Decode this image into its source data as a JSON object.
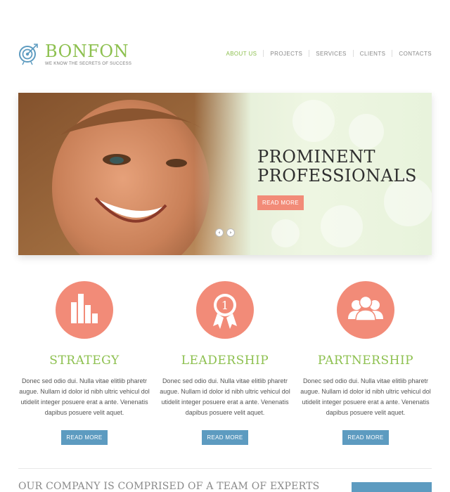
{
  "brand": {
    "title": "BONFON",
    "tagline": "WE KNOW THE SECRETS OF SUCCESS"
  },
  "nav": {
    "items": [
      {
        "label": "ABOUT US",
        "active": true
      },
      {
        "label": "PROJECTS",
        "active": false
      },
      {
        "label": "SERVICES",
        "active": false
      },
      {
        "label": "CLIENTS",
        "active": false
      },
      {
        "label": "CONTACTS",
        "active": false
      }
    ]
  },
  "slider": {
    "title_line1": "PROMINENT",
    "title_line2": "PROFESSIONALS",
    "button_label": "READ MORE",
    "prev_icon": "‹",
    "next_icon": "›"
  },
  "features": [
    {
      "icon": "bar-chart-icon",
      "title": "STRATEGY",
      "text": "Donec sed odio dui. Nulla vitae elitlib pharetr augue. Nullam id dolor id nibh ultric vehicul dol utidelit integer posuere erat a ante. Venenatis dapibus posuere velit aquet.",
      "button_label": "READ MORE"
    },
    {
      "icon": "award-ribbon-icon",
      "award_number": "1",
      "title": "LEADERSHIP",
      "text": "Donec sed odio dui. Nulla vitae elitlib pharetr augue. Nullam id dolor id nibh ultric vehicul dol utidelit integer posuere erat a ante. Venenatis dapibus posuere velit aquet.",
      "button_label": "READ MORE"
    },
    {
      "icon": "people-group-icon",
      "title": "PARTNERSHIP",
      "text": "Donec sed odio dui. Nulla vitae elitlib pharetr augue. Nullam id dolor id nibh ultric vehicul dol utidelit integer posuere erat a ante. Venenatis dapibus posuere velit aquet.",
      "button_label": "READ MORE"
    }
  ],
  "bottom": {
    "heading": "OUR COMPANY IS COMPRISED OF A TEAM OF EXPERTS"
  },
  "colors": {
    "brand_green": "#8dc04f",
    "accent_salmon": "#f28b78",
    "button_blue": "#5d9bc0"
  }
}
